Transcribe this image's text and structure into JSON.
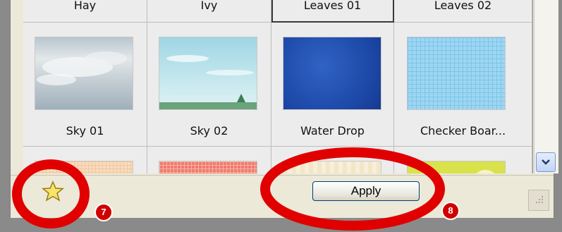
{
  "panel": {
    "top_row_labels": [
      "Hay",
      "Ivy",
      "Leaves 01",
      "Leaves 02"
    ],
    "selected_top_index": 2,
    "items": [
      {
        "label": "Sky 01",
        "icon": "sky-cloudy-thumbnail"
      },
      {
        "label": "Sky 02",
        "icon": "sky-landscape-thumbnail"
      },
      {
        "label": "Water Drop",
        "icon": "water-drop-thumbnail"
      },
      {
        "label": "Checker Boar...",
        "icon": "checker-board-thumbnail"
      }
    ],
    "bottom_row_partial": [
      "peach-grid",
      "red-grid",
      "pale-stripes",
      "yellow-green"
    ]
  },
  "toolbar": {
    "apply_label": "Apply",
    "favorite_icon": "star-icon"
  },
  "annotations": {
    "callout_7": "7",
    "callout_8": "8",
    "color": "#e00000"
  }
}
